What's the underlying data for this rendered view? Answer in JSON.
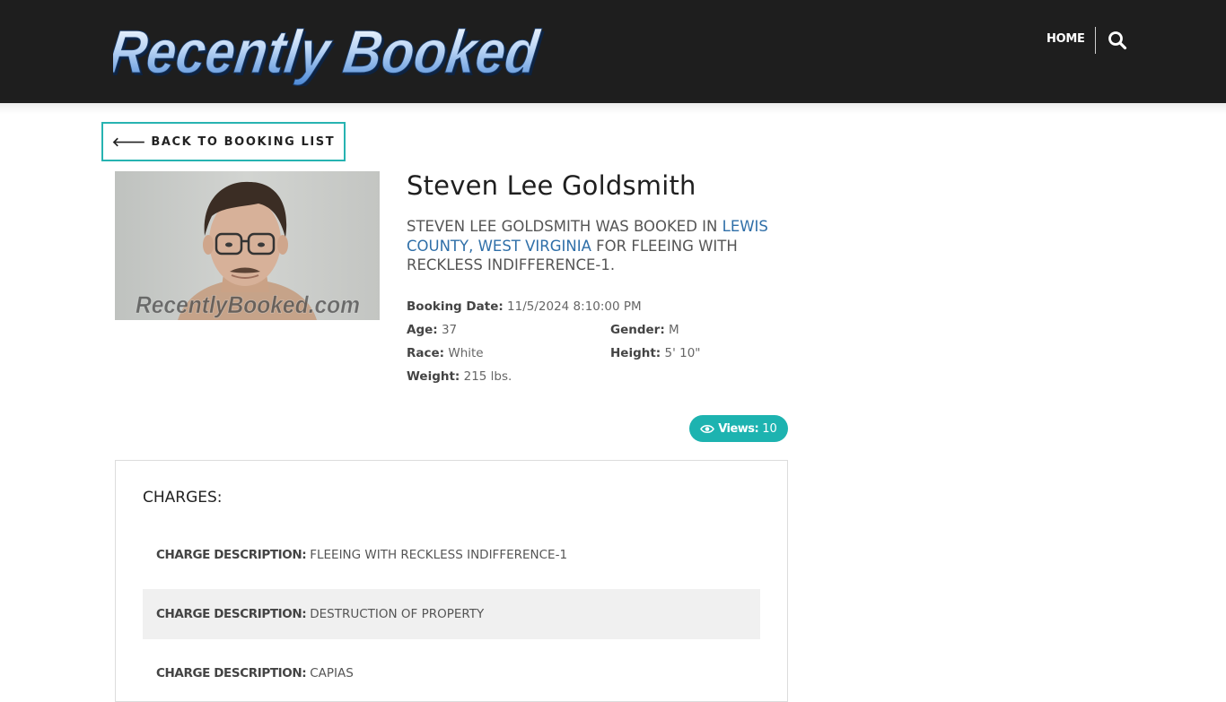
{
  "header": {
    "logo_text": "Recently Booked",
    "nav_home": "HOME",
    "search_icon": "search-icon"
  },
  "back_button": {
    "icon": "arrow-left-icon",
    "label": "BACK TO BOOKING LIST"
  },
  "photo": {
    "watermark": "RecentlyBooked.com"
  },
  "person": {
    "name": "Steven Lee Goldsmith",
    "summary_prefix": "Steven Lee Goldsmith was booked in",
    "summary_location": "Lewis County, West Virginia",
    "summary_suffix": "for FLEEING WITH RECKLESS INDIFFERENCE-1."
  },
  "details": {
    "booking_date_label": "Booking Date:",
    "booking_date": "11/5/2024 8:10:00 PM",
    "age_label": "Age:",
    "age": "37",
    "gender_label": "Gender:",
    "gender": "M",
    "race_label": "Race:",
    "race": "White",
    "height_label": "Height:",
    "height": "5' 10\"",
    "weight_label": "Weight:",
    "weight": "215 lbs."
  },
  "views": {
    "icon": "eye-icon",
    "label": "Views:",
    "count": "10"
  },
  "charges": {
    "title": "CHARGES:",
    "items": [
      {
        "label": "CHARGE DESCRIPTION:",
        "value": "FLEEING WITH RECKLESS INDIFFERENCE-1"
      },
      {
        "label": "CHARGE DESCRIPTION:",
        "value": "DESTRUCTION OF PROPERTY"
      },
      {
        "label": "CHARGE DESCRIPTION:",
        "value": "CAPIAS"
      }
    ]
  },
  "colors": {
    "header_bg": "#1e1e1e",
    "accent_teal": "#1db3b0",
    "link_blue": "#2f6fa8"
  }
}
